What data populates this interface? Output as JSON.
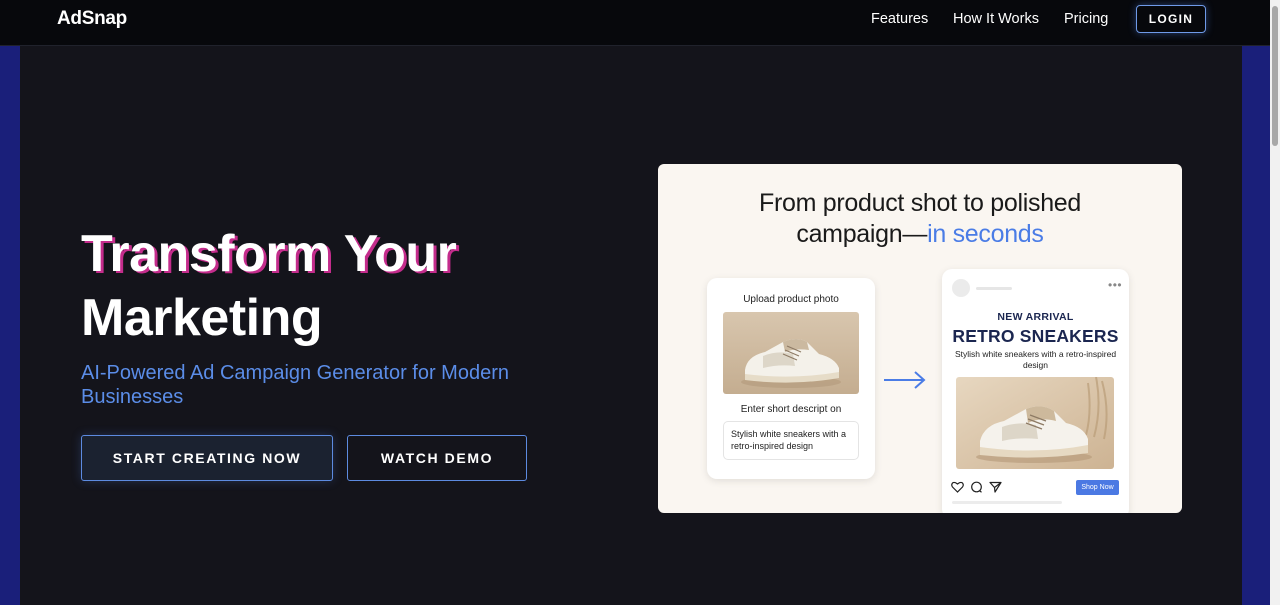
{
  "brand": {
    "logo_text": "AdSnap"
  },
  "nav": {
    "links": [
      "Features",
      "How It Works",
      "Pricing"
    ],
    "login_label": "LOGIN"
  },
  "hero": {
    "title_line1": "Transform Your",
    "title_line2": "Marketing",
    "subtitle": "AI-Powered Ad Campaign Generator for Modern Businesses",
    "primary_cta": "START CREATING NOW",
    "secondary_cta": "WATCH DEMO"
  },
  "promo": {
    "heading_line1": "From product shot to polished",
    "heading_line2_prefix": "campaign—",
    "heading_line2_accent": "in seconds",
    "upload_card": {
      "title": "Upload product photo",
      "description_label": "Enter short descript on",
      "description_text": "Stylish white sneakers with a retro-inspired design"
    },
    "post_card": {
      "kicker": "NEW ARRIVAL",
      "product_name": "RETRO SNEAKERS",
      "tagline": "Stylish white sneakers with a retro-inspired design",
      "cta": "Shop Now"
    }
  },
  "icons": [
    "arrow-right-icon",
    "heart-icon",
    "comment-icon",
    "share-icon",
    "more-dots-icon"
  ],
  "colors": {
    "accent_blue": "#4a7ce6",
    "hero_bg": "#14141b",
    "nav_bg": "#07080c",
    "page_frame": "#1a1f7a",
    "title_shadow": "#c42c8c"
  }
}
